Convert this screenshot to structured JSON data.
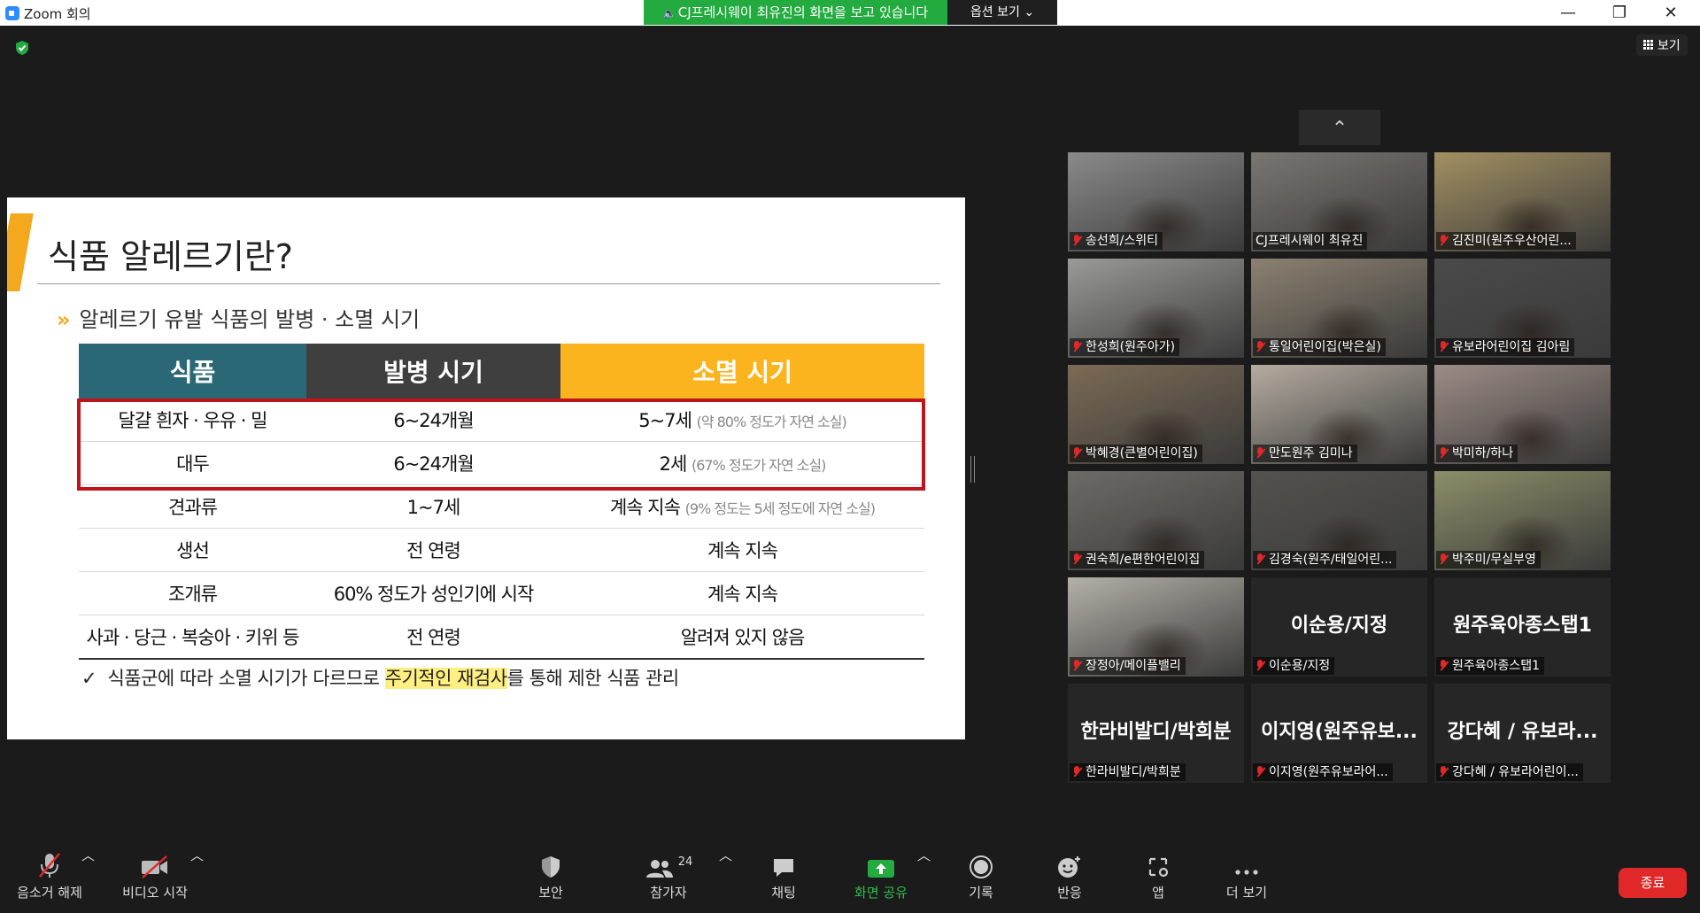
{
  "window": {
    "title": "Zoom 회의",
    "minimize": "—",
    "maximize": "❐",
    "close": "✕"
  },
  "share_banner": {
    "text": "CJ프레시웨이 최유진의 화면을 보고 있습니다",
    "options": "옵션 보기 ⌄"
  },
  "view_button": "보기",
  "slide": {
    "title": "식품 알레르기란?",
    "subtitle_chevron": "»",
    "subtitle": "알레르기 유발 식품의 발병 · 소멸 시기",
    "headers": [
      "식품",
      "발병 시기",
      "소멸 시기"
    ],
    "rows": [
      {
        "food": "달걀 흰자 · 우유 · 밀",
        "onset": "6~24개월",
        "end": "5~7세",
        "note": "(약 80% 정도가 자연 소실)"
      },
      {
        "food": "대두",
        "onset": "6~24개월",
        "end": "2세",
        "note": "(67% 정도가 자연 소실)"
      },
      {
        "food": "견과류",
        "onset": "1~7세",
        "end": "계속 지속",
        "note": "(9% 정도는 5세 정도에 자연 소실)"
      },
      {
        "food": "생선",
        "onset": "전 연령",
        "end": "계속 지속",
        "note": ""
      },
      {
        "food": "조개류",
        "onset": "60% 정도가 성인기에 시작",
        "end": "계속 지속",
        "note": ""
      },
      {
        "food": "사과 · 당근 · 복숭아 · 키위 등",
        "onset": "전 연령",
        "end": "알려져 있지 않음",
        "note": ""
      }
    ],
    "footnote_check": "✓",
    "footnote_pre": "식품군에 따라 소멸 시기가 다르므로 ",
    "footnote_highlight": "주기적인 재검사",
    "footnote_post": "를 통해 제한 식품 관리"
  },
  "gallery_collapse": "⌃",
  "participants": [
    {
      "name": "송선희/스위티",
      "muted": true,
      "video": true,
      "active": false,
      "bg": "#8a8a8a"
    },
    {
      "name": "CJ프레시웨이 최유진",
      "muted": false,
      "video": true,
      "active": true,
      "bg": "#7a7672"
    },
    {
      "name": "김진미(원주우산어린...",
      "muted": true,
      "video": true,
      "active": false,
      "bg": "#a39062"
    },
    {
      "name": "한성희(원주아가)",
      "muted": true,
      "video": true,
      "active": false,
      "bg": "#9a9a98"
    },
    {
      "name": "통일어린이집(박은실)",
      "muted": true,
      "video": true,
      "active": false,
      "bg": "#8c8170"
    },
    {
      "name": "유보라어린이집 김아림",
      "muted": true,
      "video": true,
      "active": false,
      "bg": "#4a4a4a"
    },
    {
      "name": "박혜경(큰별어린이집)",
      "muted": true,
      "video": true,
      "active": false,
      "bg": "#7c6a55"
    },
    {
      "name": "만도원주 김미나",
      "muted": true,
      "video": true,
      "active": false,
      "bg": "#b5aca0"
    },
    {
      "name": "박미하/하나",
      "muted": true,
      "video": true,
      "active": false,
      "bg": "#9d8c86"
    },
    {
      "name": "권숙희/e편한어린이집",
      "muted": true,
      "video": true,
      "active": false,
      "bg": "#6d6b66"
    },
    {
      "name": "김경숙(원주/태일어린...",
      "muted": true,
      "video": true,
      "active": false,
      "bg": "#53524e"
    },
    {
      "name": "박주미/무실부영",
      "muted": true,
      "video": true,
      "active": false,
      "bg": "#8c8f68"
    },
    {
      "name": "장정아/메이플밸리",
      "muted": true,
      "video": true,
      "active": false,
      "bg": "#b3b1a8"
    },
    {
      "name": "이순용/지정",
      "display": "이순용/지정",
      "muted": true,
      "video": false,
      "active": false,
      "bg": "#262626"
    },
    {
      "name": "원주육아종스탭1",
      "display": "원주육아종스탭1",
      "muted": true,
      "video": false,
      "active": false,
      "bg": "#262626"
    },
    {
      "name": "한라비발디/박희분",
      "display": "한라비발디/박희분",
      "muted": true,
      "video": false,
      "active": false,
      "bg": "#262626"
    },
    {
      "name": "이지영(원주유보라어...",
      "display": "이지영(원주유보...",
      "muted": true,
      "video": false,
      "active": false,
      "bg": "#262626"
    },
    {
      "name": "강다혜 / 유보라어린이...",
      "display": "강다혜 / 유보라...",
      "muted": true,
      "video": false,
      "active": false,
      "bg": "#262626"
    }
  ],
  "toolbar": {
    "unmute": "음소거 해제",
    "start_video": "비디오 시작",
    "security": "보안",
    "participants": "참가자",
    "participants_count": "24",
    "chat": "채팅",
    "share_screen": "화면 공유",
    "record": "기록",
    "reactions": "반응",
    "apps": "앱",
    "more": "더 보기",
    "end": "종료"
  },
  "colors": {
    "share_green": "#23ab3f",
    "end_red": "#e02828",
    "table_teal": "#2b6877",
    "table_dark": "#3f3f3f",
    "table_yellow": "#fbb41d",
    "redbox": "#c0141c",
    "active_tile": "#d4e86a"
  }
}
